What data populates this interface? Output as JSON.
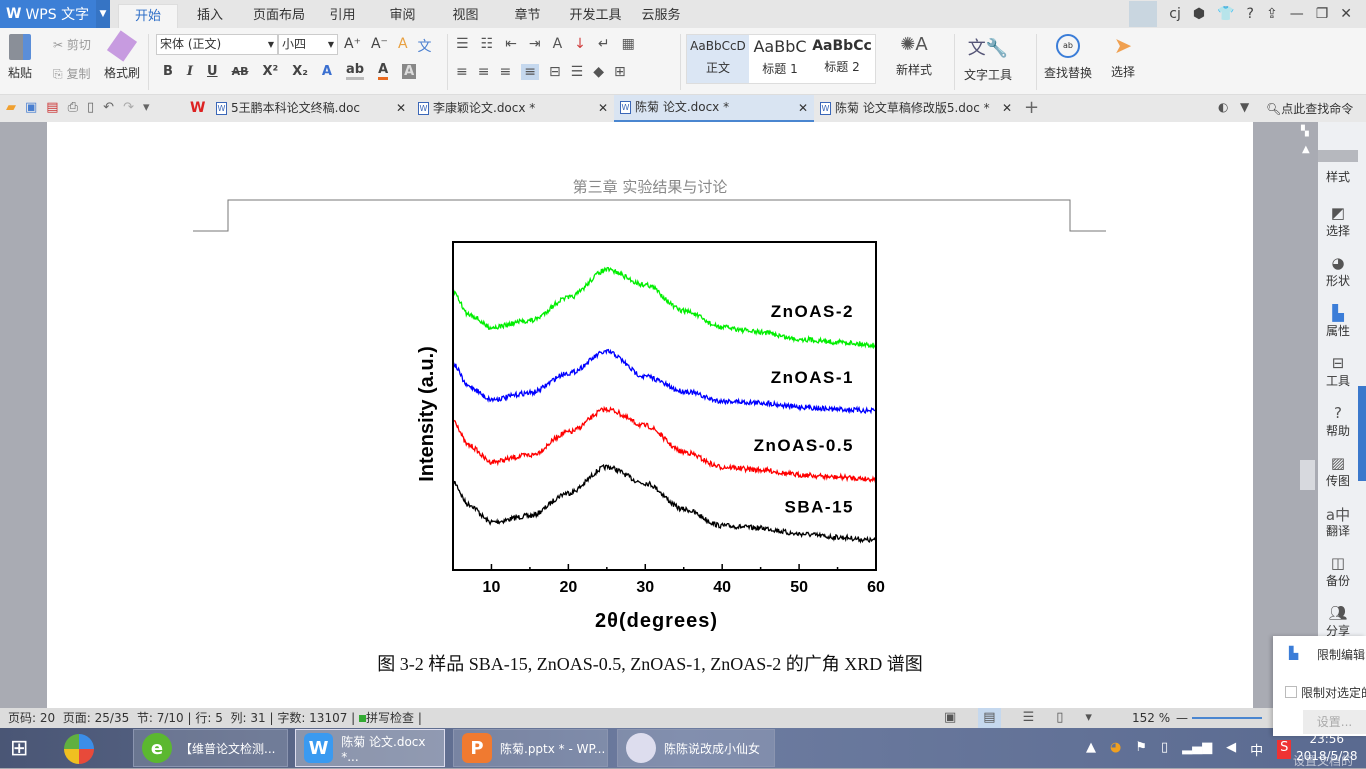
{
  "app": {
    "name": "WPS 文字",
    "user": "cj"
  },
  "menu_tabs": [
    "开始",
    "插入",
    "页面布局",
    "引用",
    "审阅",
    "视图",
    "章节",
    "开发工具",
    "云服务"
  ],
  "ribbon": {
    "paste": "粘贴",
    "cut": "剪切",
    "copy": "复制",
    "format_painter": "格式刷",
    "font_name": "宋体 (正文)",
    "font_size": "小四",
    "styles": [
      {
        "preview": "AaBbCcD",
        "label": "正文"
      },
      {
        "preview": "AaBbC",
        "label": "标题 1"
      },
      {
        "preview": "AaBbCc",
        "label": "标题 2"
      }
    ],
    "new_style": "新样式",
    "text_tools": "文字工具",
    "find_replace": "查找替换",
    "select": "选择"
  },
  "doc_tabs": [
    {
      "label": "5王鹏本科论文终稿.doc",
      "active": false
    },
    {
      "label": "李康颖论文.docx *",
      "active": false
    },
    {
      "label": "陈菊 论文.docx *",
      "active": true
    },
    {
      "label": "陈菊 论文草稿修改版5.doc *",
      "active": false
    }
  ],
  "command_search": "点此查找命令",
  "page": {
    "header": "第三章  实验结果与讨论",
    "caption": "图 3-2  样品 SBA-15, ZnOAS-0.5, ZnOAS-1, ZnOAS-2 的广角 XRD 谱图"
  },
  "chart_data": {
    "type": "line",
    "xlabel": "2θ(degrees)",
    "ylabel": "Intensity (a.u.)",
    "xlim": [
      5,
      60
    ],
    "ylim": [
      0,
      100
    ],
    "xticks": [
      10,
      20,
      30,
      40,
      50,
      60
    ],
    "grid": false,
    "x": [
      5,
      7,
      10,
      15,
      20,
      25,
      30,
      35,
      40,
      45,
      50,
      55,
      60
    ],
    "series": [
      {
        "name": "SBA-15",
        "color": "#000000",
        "values": [
          26.8,
          20,
          14.6,
          16.5,
          23.5,
          31.4,
          26.5,
          18.5,
          13.5,
          12.8,
          11,
          10,
          9
        ]
      },
      {
        "name": "ZnOAS-0.5",
        "color": "#ff0000",
        "values": [
          45.7,
          38,
          33,
          35,
          42,
          49,
          44,
          36,
          31.4,
          30.5,
          29,
          28.3,
          27.7
        ]
      },
      {
        "name": "ZnOAS-1",
        "color": "#0000ff",
        "values": [
          62.8,
          56,
          52,
          54,
          60,
          66.5,
          59,
          54.5,
          51.5,
          51,
          49.7,
          49,
          48.5
        ]
      },
      {
        "name": "ZnOAS-2",
        "color": "#00ee00",
        "values": [
          84.8,
          78,
          74,
          76,
          83,
          91.5,
          87,
          79,
          74,
          72.5,
          70.4,
          69.5,
          68.6
        ]
      }
    ]
  },
  "sidebar": [
    "样式",
    "选择",
    "形状",
    "属性",
    "工具",
    "帮助",
    "传图",
    "翻译",
    "备份",
    "分享"
  ],
  "status": {
    "page_no": "页码: 20",
    "pages": "页面: 25/35",
    "section": "节: 7/10",
    "row": "行: 5",
    "col": "列: 31",
    "words": "字数: 13107",
    "spell": "拼写检查",
    "zoom": "152 %"
  },
  "popup": {
    "title": "限制编辑",
    "option": "限制对选定的",
    "button": "设置...",
    "option2": "设置文档的"
  },
  "taskbar": {
    "items": [
      "【维普论文检测...",
      "陈菊 论文.docx *...",
      "陈菊.pptx * - WP...",
      "陈陈说改成小仙女"
    ],
    "ime": "中",
    "time": "23:56",
    "date": "2018/5/28"
  }
}
